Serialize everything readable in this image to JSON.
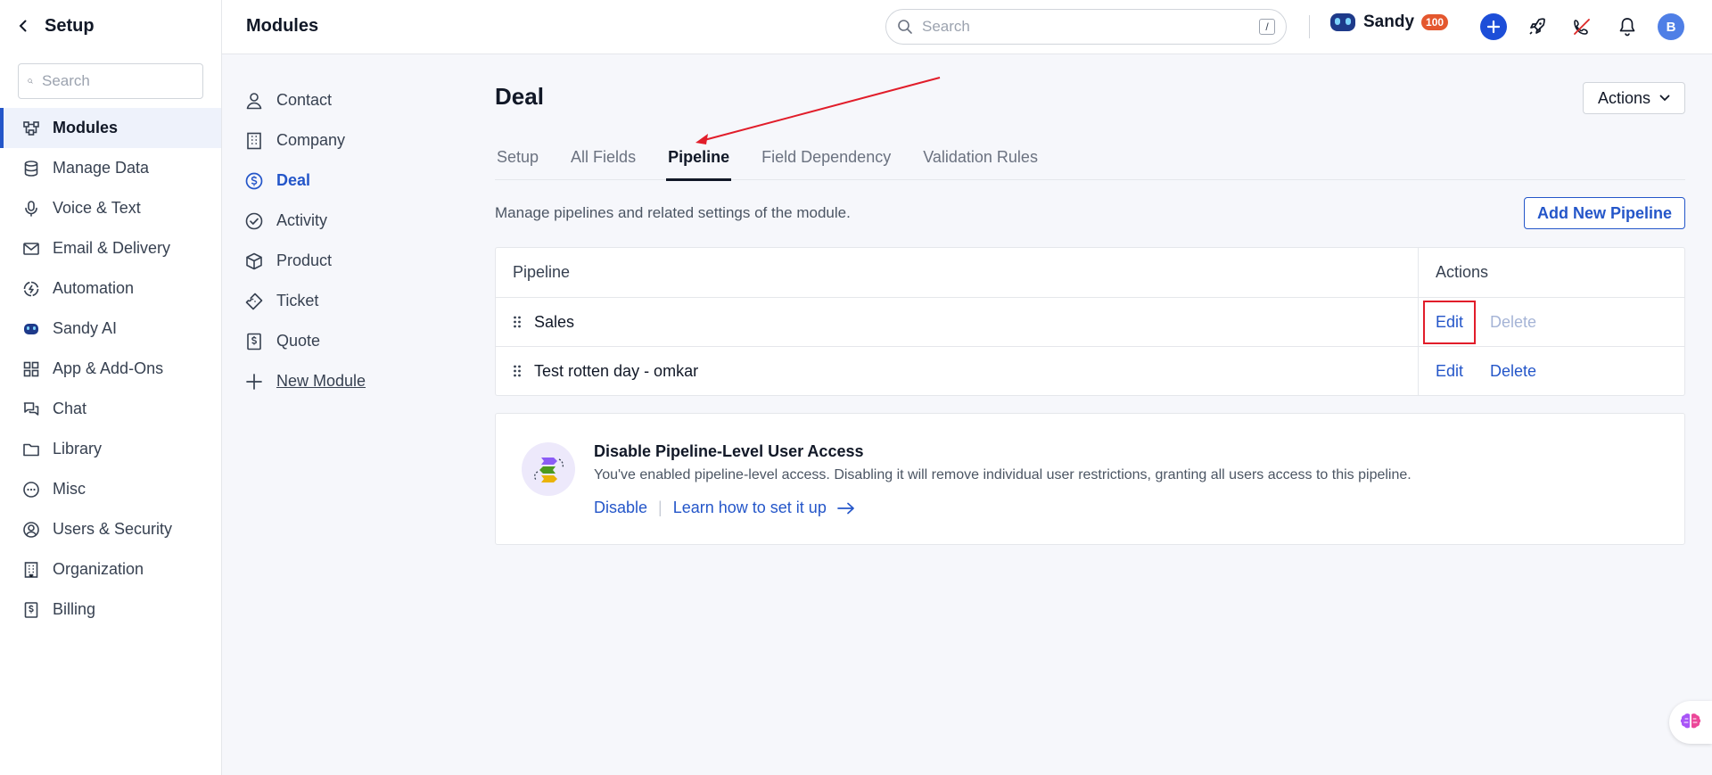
{
  "sidebar": {
    "title": "Setup",
    "search_placeholder": "Search",
    "items": [
      {
        "label": "Modules",
        "icon": "modules-icon",
        "active": true
      },
      {
        "label": "Manage Data",
        "icon": "database-icon"
      },
      {
        "label": "Voice & Text",
        "icon": "microphone-icon"
      },
      {
        "label": "Email & Delivery",
        "icon": "envelope-icon"
      },
      {
        "label": "Automation",
        "icon": "automation-icon"
      },
      {
        "label": "Sandy AI",
        "icon": "sandy-ai-icon"
      },
      {
        "label": "App & Add-Ons",
        "icon": "apps-grid-icon"
      },
      {
        "label": "Chat",
        "icon": "chat-icon"
      },
      {
        "label": "Library",
        "icon": "folder-icon"
      },
      {
        "label": "Misc",
        "icon": "more-circle-icon"
      },
      {
        "label": "Users & Security",
        "icon": "user-circle-icon"
      },
      {
        "label": "Organization",
        "icon": "building-icon"
      },
      {
        "label": "Billing",
        "icon": "billing-icon"
      }
    ]
  },
  "topbar": {
    "title": "Modules",
    "search_placeholder": "Search",
    "search_shortcut": "/",
    "sandy_name": "Sandy",
    "sandy_badge": "100",
    "avatar_initial": "B"
  },
  "modules": {
    "items": [
      {
        "label": "Contact",
        "icon": "person-icon"
      },
      {
        "label": "Company",
        "icon": "building-icon"
      },
      {
        "label": "Deal",
        "icon": "dollar-circle-icon",
        "active": true
      },
      {
        "label": "Activity",
        "icon": "check-circle-icon"
      },
      {
        "label": "Product",
        "icon": "cube-icon"
      },
      {
        "label": "Ticket",
        "icon": "ticket-icon"
      },
      {
        "label": "Quote",
        "icon": "quote-icon"
      }
    ],
    "new_module_label": "New Module"
  },
  "main": {
    "title": "Deal",
    "actions_label": "Actions",
    "tabs": [
      {
        "label": "Setup"
      },
      {
        "label": "All Fields"
      },
      {
        "label": "Pipeline",
        "active": true
      },
      {
        "label": "Field Dependency"
      },
      {
        "label": "Validation Rules"
      }
    ],
    "description": "Manage pipelines and related settings of the module.",
    "add_pipeline_label": "Add New Pipeline",
    "table": {
      "headers": [
        "Pipeline",
        "Actions"
      ],
      "rows": [
        {
          "name": "Sales",
          "edit": "Edit",
          "delete": "Delete",
          "delete_disabled": true
        },
        {
          "name": "Test rotten day - omkar",
          "edit": "Edit",
          "delete": "Delete",
          "delete_disabled": false
        }
      ]
    },
    "info": {
      "title": "Disable Pipeline-Level User Access",
      "text": "You've enabled pipeline-level access. Disabling it will remove individual user restrictions, granting all users access to this pipeline.",
      "disable_label": "Disable",
      "learn_label": "Learn how to set it up"
    }
  },
  "colors": {
    "accent": "#2456c9",
    "annotation_red": "#e11d2a",
    "badge": "#e4572e"
  }
}
